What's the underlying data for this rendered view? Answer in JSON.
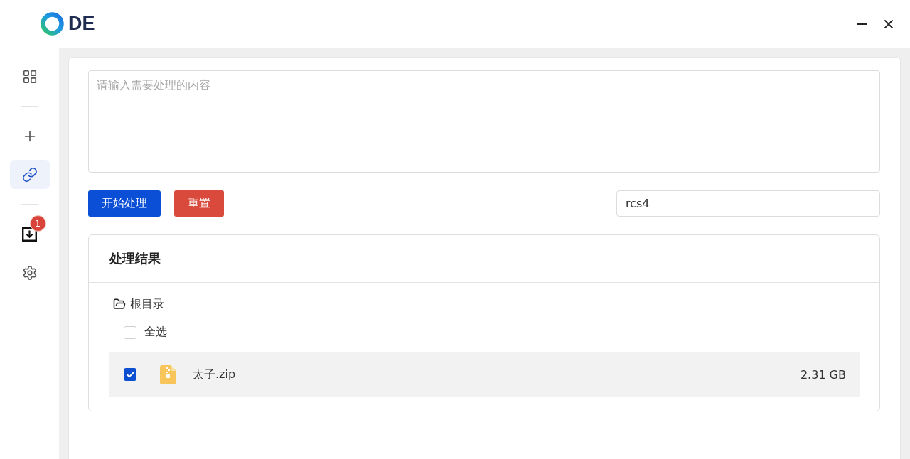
{
  "window": {
    "logo_text": "DE",
    "controls": [
      {
        "kind": "minimize"
      },
      {
        "kind": "close"
      }
    ]
  },
  "sidebar": {
    "groups": [
      {
        "items": [
          {
            "kind": "grid",
            "selected": false
          }
        ]
      },
      {
        "items": [
          {
            "kind": "add",
            "selected": false
          },
          {
            "kind": "link",
            "selected": true
          }
        ]
      },
      {
        "items": [
          {
            "kind": "download",
            "selected": false,
            "badge": "1"
          },
          {
            "kind": "settings",
            "selected": false
          }
        ]
      }
    ]
  },
  "input": {
    "placeholder": "请输入需要处理的内容"
  },
  "actions": [
    {
      "kind": "primary",
      "label": "开始处理"
    },
    {
      "kind": "danger",
      "label": "重置"
    }
  ],
  "code_field": {
    "value": "rcs4"
  },
  "results": {
    "title": "处理结果",
    "folder": "根目录",
    "select_all": {
      "label": "全选",
      "checked": false
    },
    "files": [
      {
        "name": "太子.zip",
        "size": "2.31 GB",
        "checked": true
      }
    ]
  }
}
